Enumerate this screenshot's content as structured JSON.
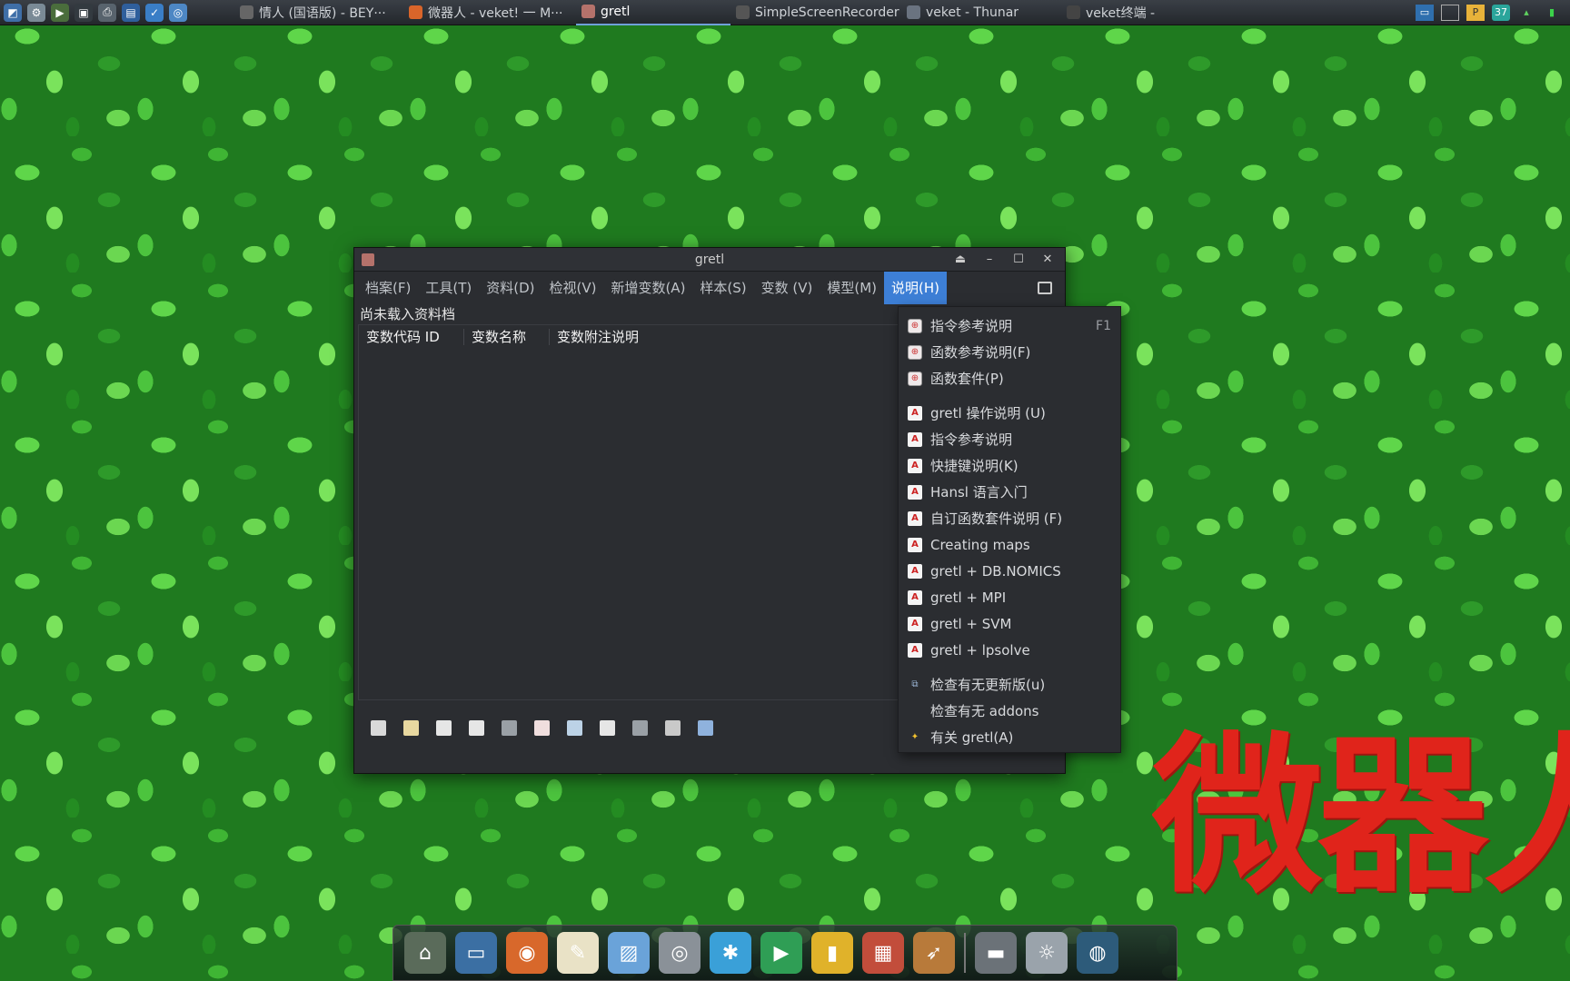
{
  "taskbar": {
    "launchers": [
      {
        "icon": "system-monitor-icon",
        "color": "#3f6fa8",
        "glyph": "◩"
      },
      {
        "icon": "settings-gear-icon",
        "color": "#7a8a96",
        "glyph": "⚙"
      },
      {
        "icon": "play-icon",
        "color": "#4a6d3c",
        "glyph": "▶"
      },
      {
        "icon": "terminal-icon",
        "color": "#333a40",
        "glyph": "▣"
      },
      {
        "icon": "printer-icon",
        "color": "#58636d",
        "glyph": "⎙"
      },
      {
        "icon": "photo-icon",
        "color": "#2f5f9c",
        "glyph": "▤"
      },
      {
        "icon": "checkmark-icon",
        "color": "#3a7ec6",
        "glyph": "✓"
      },
      {
        "icon": "globe-icon",
        "color": "#4d87c4",
        "glyph": "◎"
      }
    ],
    "tasks": [
      {
        "label": "情人 (国语版) - BEY···",
        "icon": "music-icon",
        "color": "#666",
        "active": false
      },
      {
        "label": "微器人 - veket! 一 M···",
        "icon": "firefox-icon",
        "color": "#d9652a",
        "active": false
      },
      {
        "label": "gretl",
        "icon": "gretl-icon",
        "color": "#b5726b",
        "active": true
      },
      {
        "label": "SimpleScreenRecorder",
        "icon": "recorder-icon",
        "color": "#555",
        "active": false
      },
      {
        "label": "veket - Thunar",
        "icon": "folder-icon",
        "color": "#6a7380",
        "active": false
      },
      {
        "label": "veket终端 -",
        "icon": "terminal-icon",
        "color": "#444",
        "active": false
      }
    ],
    "tray": {
      "battery_label": "37"
    }
  },
  "window": {
    "title": "gretl",
    "menus": [
      {
        "label": "档案(F)",
        "active": false
      },
      {
        "label": "工具(T)",
        "active": false
      },
      {
        "label": "资料(D)",
        "active": false
      },
      {
        "label": "检视(V)",
        "active": false
      },
      {
        "label": "新增变数(A)",
        "active": false
      },
      {
        "label": "样本(S)",
        "active": false
      },
      {
        "label": "变数 (V)",
        "active": false
      },
      {
        "label": "模型(M)",
        "active": false
      },
      {
        "label": "说明(H)",
        "active": true
      }
    ],
    "status": "尚未载入资料档",
    "columns": [
      "变数代码 ID",
      "变数名称",
      "变数附注说明"
    ],
    "toolbar_icons": [
      {
        "name": "calculator-icon",
        "color": "#d9d9d9"
      },
      {
        "name": "edit-script-icon",
        "color": "#e8d8a0"
      },
      {
        "name": "console-icon",
        "color": "#e6e6e6"
      },
      {
        "name": "session-icon",
        "color": "#e6e6e6"
      },
      {
        "name": "formula-icon",
        "color": "#9aa0a6"
      },
      {
        "name": "help-icon",
        "color": "#f0dede"
      },
      {
        "name": "search-icon",
        "color": "#bcd2e6"
      },
      {
        "name": "graph-icon",
        "color": "#e6e6e6"
      },
      {
        "name": "function-icon",
        "color": "#9aa0a6"
      },
      {
        "name": "database-icon",
        "color": "#c9c9c9"
      },
      {
        "name": "save-icon",
        "color": "#8fb2dd"
      }
    ]
  },
  "help_menu": {
    "groups": [
      [
        {
          "label": "指令参考说明",
          "icon": "help",
          "shortcut": "F1"
        },
        {
          "label": "函数参考说明(F)",
          "icon": "help",
          "shortcut": ""
        },
        {
          "label": "函数套件(P)",
          "icon": "help",
          "shortcut": ""
        }
      ],
      [
        {
          "label": "gretl 操作说明 (U)",
          "icon": "pdf",
          "shortcut": ""
        },
        {
          "label": "指令参考说明",
          "icon": "pdf",
          "shortcut": ""
        },
        {
          "label": "快捷键说明(K)",
          "icon": "pdf",
          "shortcut": ""
        },
        {
          "label": "Hansl 语言入门",
          "icon": "pdf",
          "shortcut": ""
        },
        {
          "label": "自订函数套件说明 (F)",
          "icon": "pdf",
          "shortcut": ""
        },
        {
          "label": "Creating maps",
          "icon": "pdf",
          "shortcut": ""
        },
        {
          "label": "gretl + DB.NOMICS",
          "icon": "pdf",
          "shortcut": ""
        },
        {
          "label": "gretl + MPI",
          "icon": "pdf",
          "shortcut": ""
        },
        {
          "label": "gretl + SVM",
          "icon": "pdf",
          "shortcut": ""
        },
        {
          "label": "gretl + lpsolve",
          "icon": "pdf",
          "shortcut": ""
        }
      ],
      [
        {
          "label": "检查有无更新版(u)",
          "icon": "update",
          "shortcut": ""
        },
        {
          "label": "检查有无 addons",
          "icon": "blank",
          "shortcut": ""
        },
        {
          "label": "有关 gretl(A)",
          "icon": "star",
          "shortcut": ""
        }
      ]
    ]
  },
  "overlay_text": "微器人",
  "dock": [
    {
      "name": "desktop-icon",
      "color": "#5a6b5a",
      "glyph": "⌂"
    },
    {
      "name": "monitor-icon",
      "color": "#3b6fa3",
      "glyph": "▭"
    },
    {
      "name": "firefox-icon",
      "color": "#d8682b",
      "glyph": "◉"
    },
    {
      "name": "text-editor-icon",
      "color": "#e9e2c6",
      "glyph": "✎"
    },
    {
      "name": "image-viewer-icon",
      "color": "#6aa3d9",
      "glyph": "▨"
    },
    {
      "name": "disc-icon",
      "color": "#8a9198",
      "glyph": "◎"
    },
    {
      "name": "network-icon",
      "color": "#3aa0d8",
      "glyph": "✱"
    },
    {
      "name": "media-player-icon",
      "color": "#2f9e55",
      "glyph": "▶"
    },
    {
      "name": "notes-icon",
      "color": "#e0b22a",
      "glyph": "▮"
    },
    {
      "name": "spreadsheet-icon",
      "color": "#c24d3b",
      "glyph": "▦"
    },
    {
      "name": "rocket-icon",
      "color": "#b87a3a",
      "glyph": "➶"
    },
    {
      "name": "drive-icon",
      "color": "#6b7278",
      "glyph": "▬"
    },
    {
      "name": "settings-sun-icon",
      "color": "#9aa3ab",
      "glyph": "☼"
    },
    {
      "name": "globe-icon",
      "color": "#2d5b7a",
      "glyph": "◍"
    }
  ]
}
